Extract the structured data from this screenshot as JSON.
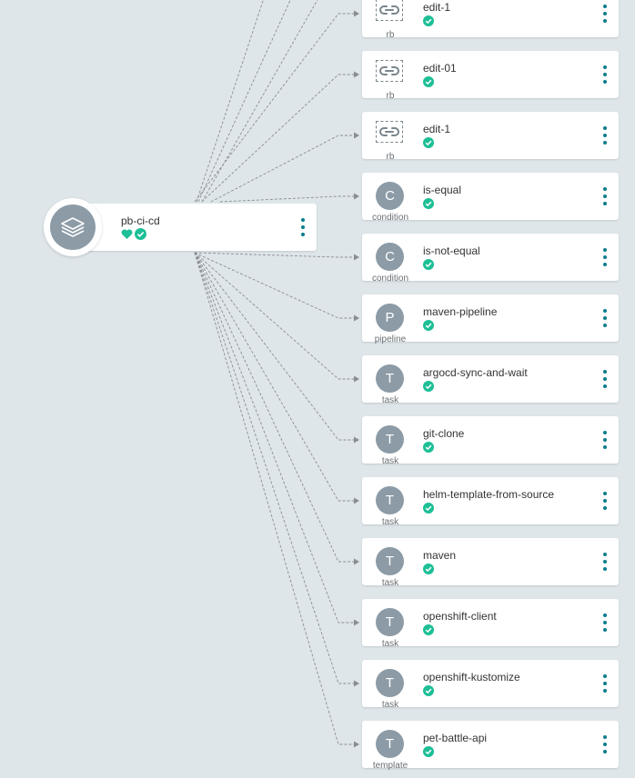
{
  "colors": {
    "background": "#dee6ea",
    "badge": "#8c9ba6",
    "success": "#1dbf96",
    "kebab": "#0a7d8c",
    "edge": "#8a8d90"
  },
  "root": {
    "name": "pb-ci-cd",
    "icon": "layers-icon",
    "status_icons": [
      "heart-icon",
      "check-circle-icon"
    ]
  },
  "nodes": [
    {
      "name": "edit-1",
      "kind": "rb",
      "badge": "",
      "icon": "link-icon",
      "status": "synced"
    },
    {
      "name": "edit-01",
      "kind": "rb",
      "badge": "",
      "icon": "link-icon",
      "status": "synced"
    },
    {
      "name": "edit-1",
      "kind": "rb",
      "badge": "",
      "icon": "link-icon",
      "status": "synced"
    },
    {
      "name": "is-equal",
      "kind": "condition",
      "badge": "C",
      "status": "synced"
    },
    {
      "name": "is-not-equal",
      "kind": "condition",
      "badge": "C",
      "status": "synced"
    },
    {
      "name": "maven-pipeline",
      "kind": "pipeline",
      "badge": "P",
      "status": "synced"
    },
    {
      "name": "argocd-sync-and-wait",
      "kind": "task",
      "badge": "T",
      "status": "synced"
    },
    {
      "name": "git-clone",
      "kind": "task",
      "badge": "T",
      "status": "synced"
    },
    {
      "name": "helm-template-from-source",
      "kind": "task",
      "badge": "T",
      "status": "synced"
    },
    {
      "name": "maven",
      "kind": "task",
      "badge": "T",
      "status": "synced"
    },
    {
      "name": "openshift-client",
      "kind": "task",
      "badge": "T",
      "status": "synced"
    },
    {
      "name": "openshift-kustomize",
      "kind": "task",
      "badge": "T",
      "status": "synced"
    },
    {
      "name": "pet-battle-api",
      "kind": "template",
      "badge": "T",
      "status": "synced"
    }
  ]
}
